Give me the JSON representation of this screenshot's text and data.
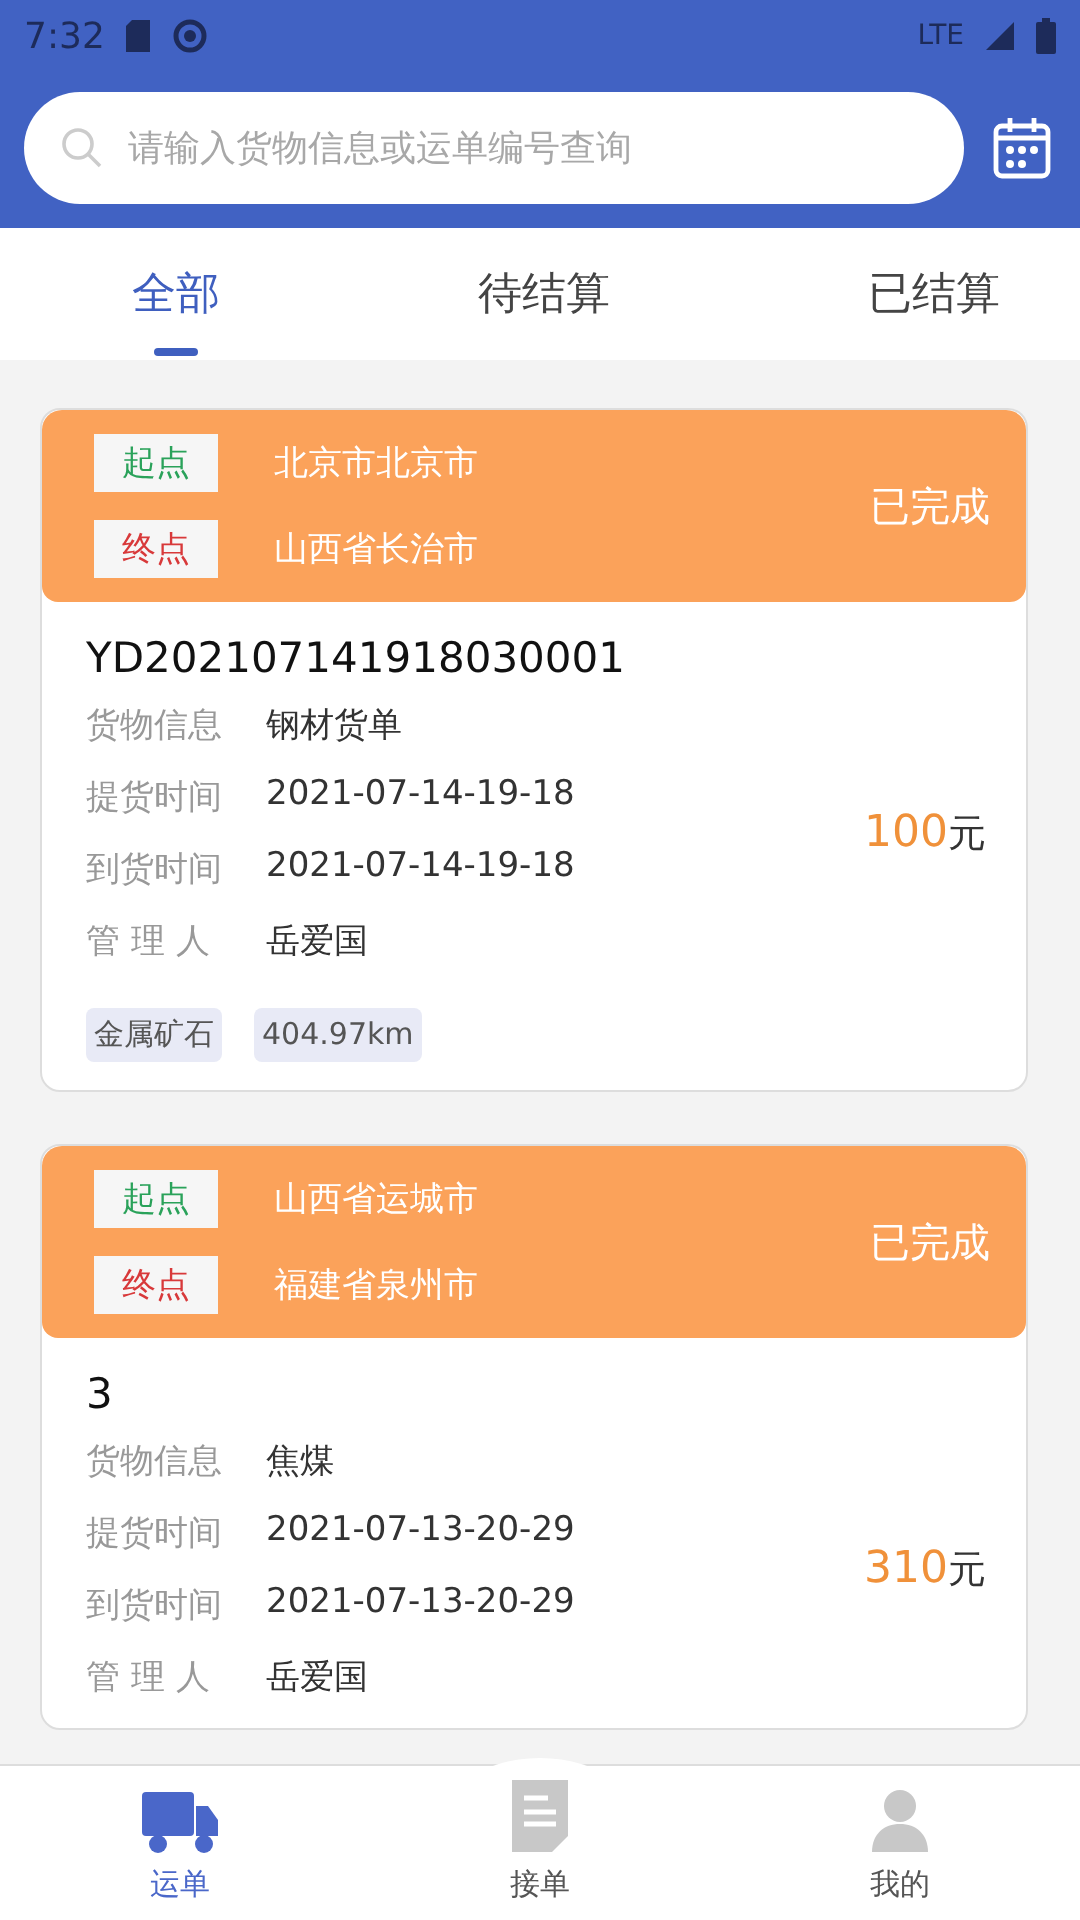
{
  "status_bar": {
    "time": "7:32",
    "network": "LTE"
  },
  "search": {
    "placeholder": "请输入货物信息或运单编号查询"
  },
  "tabs": [
    {
      "label": "全部",
      "selected": true
    },
    {
      "label": "待结算",
      "selected": false
    },
    {
      "label": "已结算",
      "selected": false
    }
  ],
  "orders": [
    {
      "origin_label": "起点",
      "origin": "北京市北京市",
      "dest_label": "终点",
      "destination": "山西省长治市",
      "status": "已完成",
      "number": "YD202107141918030001",
      "fields": [
        {
          "label": "货物信息",
          "value": "钢材货单"
        },
        {
          "label": "提货时间",
          "value": "2021-07-14-19-18"
        },
        {
          "label": "到货时间",
          "value": "2021-07-14-19-18"
        },
        {
          "label": "管 理 人",
          "value": "岳爱国"
        }
      ],
      "amount": "100",
      "unit": "元",
      "tags": [
        "金属矿石",
        "404.97km"
      ]
    },
    {
      "origin_label": "起点",
      "origin": "山西省运城市",
      "dest_label": "终点",
      "destination": "福建省泉州市",
      "status": "已完成",
      "number": "3",
      "fields": [
        {
          "label": "货物信息",
          "value": "焦煤"
        },
        {
          "label": "提货时间",
          "value": "2021-07-13-20-29"
        },
        {
          "label": "到货时间",
          "value": "2021-07-13-20-29"
        },
        {
          "label": "管 理 人",
          "value": "岳爱国"
        }
      ],
      "amount": "310",
      "unit": "元"
    }
  ],
  "nav": [
    {
      "label": "运单",
      "kind": "truck",
      "selected": true
    },
    {
      "label": "接单",
      "kind": "document",
      "selected": false
    },
    {
      "label": "我的",
      "kind": "person",
      "selected": false
    }
  ]
}
